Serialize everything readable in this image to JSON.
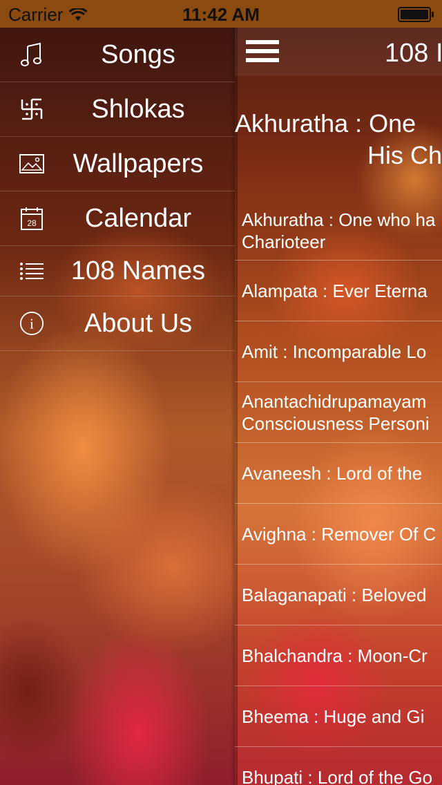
{
  "status_bar": {
    "carrier": "Carrier",
    "time": "11:42 AM"
  },
  "menu": {
    "items": [
      {
        "label": "Songs",
        "icon": "music-note-icon"
      },
      {
        "label": "Shlokas",
        "icon": "swastika-icon"
      },
      {
        "label": "Wallpapers",
        "icon": "image-icon"
      },
      {
        "label": "Calendar",
        "icon": "calendar-icon",
        "icon_text": "28"
      },
      {
        "label": "108 Names",
        "icon": "list-icon"
      },
      {
        "label": "About Us",
        "icon": "info-icon",
        "icon_text": "i"
      }
    ]
  },
  "header": {
    "title": "108 I"
  },
  "detail": {
    "heading_line1": "Akhuratha : One",
    "heading_line2": "His Ch"
  },
  "names": [
    {
      "line1": "Akhuratha : One who ha",
      "line2": "Charioteer"
    },
    {
      "line1": "Alampata : Ever Eterna"
    },
    {
      "line1": "Amit : Incomparable Lo"
    },
    {
      "line1": "Anantachidrupamayam",
      "line2": "Consciousness Personi"
    },
    {
      "line1": "Avaneesh : Lord of the"
    },
    {
      "line1": "Avighna : Remover Of C"
    },
    {
      "line1": "Balaganapati : Beloved"
    },
    {
      "line1": "Bhalchandra : Moon-Cr"
    },
    {
      "line1": "Bheema : Huge and Gi"
    },
    {
      "line1": "Bhupati : Lord of the Go"
    }
  ]
}
